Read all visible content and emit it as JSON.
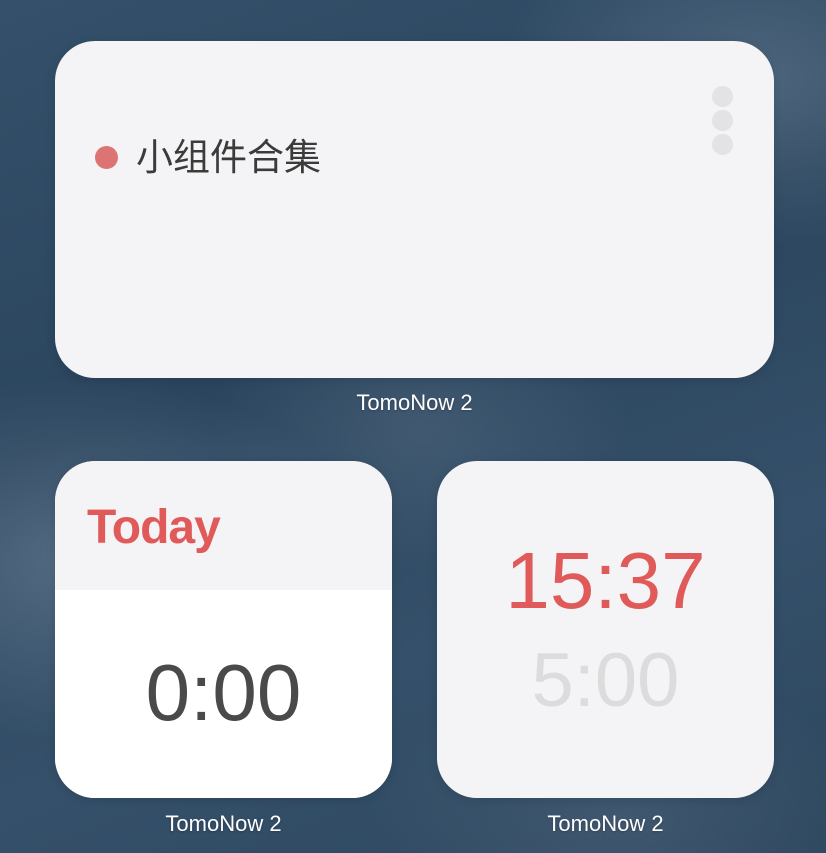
{
  "colors": {
    "accent_red": "#e05a5a",
    "dot_red": "#dd7474"
  },
  "large_widget": {
    "title": "小组件合集",
    "menu_icon": "three-dots-vertical-icon",
    "label": "TomoNow 2"
  },
  "today_widget": {
    "title": "Today",
    "time": "0:00",
    "label": "TomoNow 2"
  },
  "clock_widget": {
    "current_time": "15:37",
    "secondary_time": "5:00",
    "label": "TomoNow 2"
  }
}
